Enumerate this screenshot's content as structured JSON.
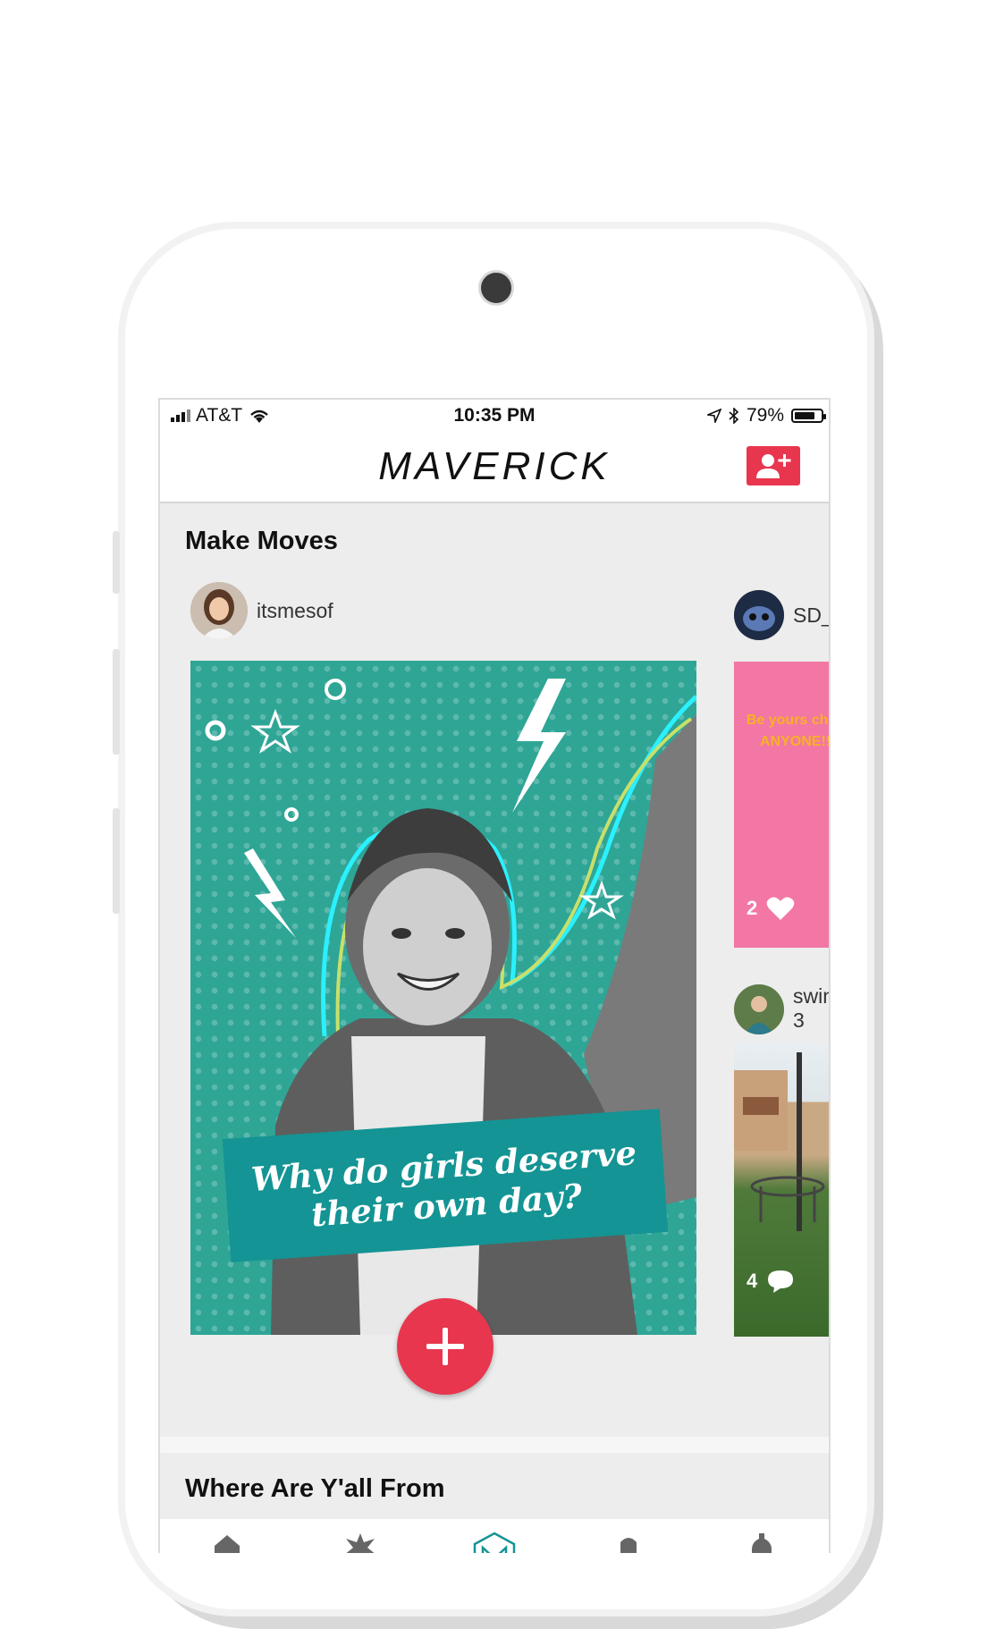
{
  "status_bar": {
    "carrier": "AT&T",
    "time": "10:35 PM",
    "battery": "79%",
    "battery_level": 0.79
  },
  "header": {
    "brand": "MAVERICK",
    "add_user_icon": "add-user-icon"
  },
  "make_moves": {
    "title": "Make Moves",
    "main_post": {
      "username": "itsmesof",
      "question": "Why do girls deserve their own day?"
    },
    "side_posts": [
      {
        "username": "SD_R",
        "text": "Be yours change y ANYONE!! boy",
        "likes": "2"
      },
      {
        "username": "swim",
        "count": "3",
        "comments": "4"
      }
    ]
  },
  "where_from": {
    "title": "Where Are Y'all From"
  },
  "colors": {
    "accent": "#e8364f",
    "teal": "#2fa596",
    "banner": "#149494",
    "pink": "#f377a4"
  }
}
